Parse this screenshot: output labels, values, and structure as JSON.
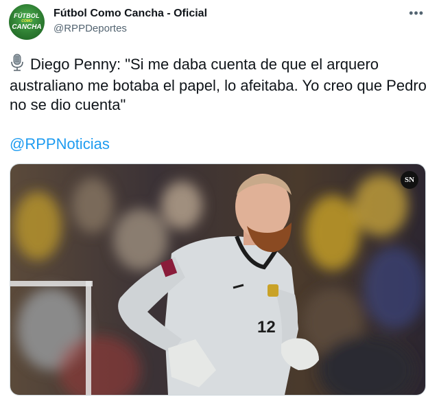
{
  "account": {
    "name": "Fútbol Como Cancha - Oficial",
    "handle": "@RPPDeportes",
    "avatar_text": [
      "FÚTBOL",
      "COMO",
      "CANCHA"
    ]
  },
  "tweet": {
    "more_icon": "more-horizontal-icon",
    "text_icon": "microphone-icon",
    "text": "Diego Penny: \"Si me daba cuenta de que el arquero australiano me botaba el papel, lo afeitaba. Yo creo que Pedro no se dio cuenta\"",
    "mention": "@RPPNoticias"
  },
  "photo": {
    "watermark": "SN",
    "jersey_number": "12",
    "colors": {
      "jersey": "#d8dcdf",
      "crowd_yellow": "#c9a227",
      "crowd_dark": "#2a2a30"
    }
  }
}
